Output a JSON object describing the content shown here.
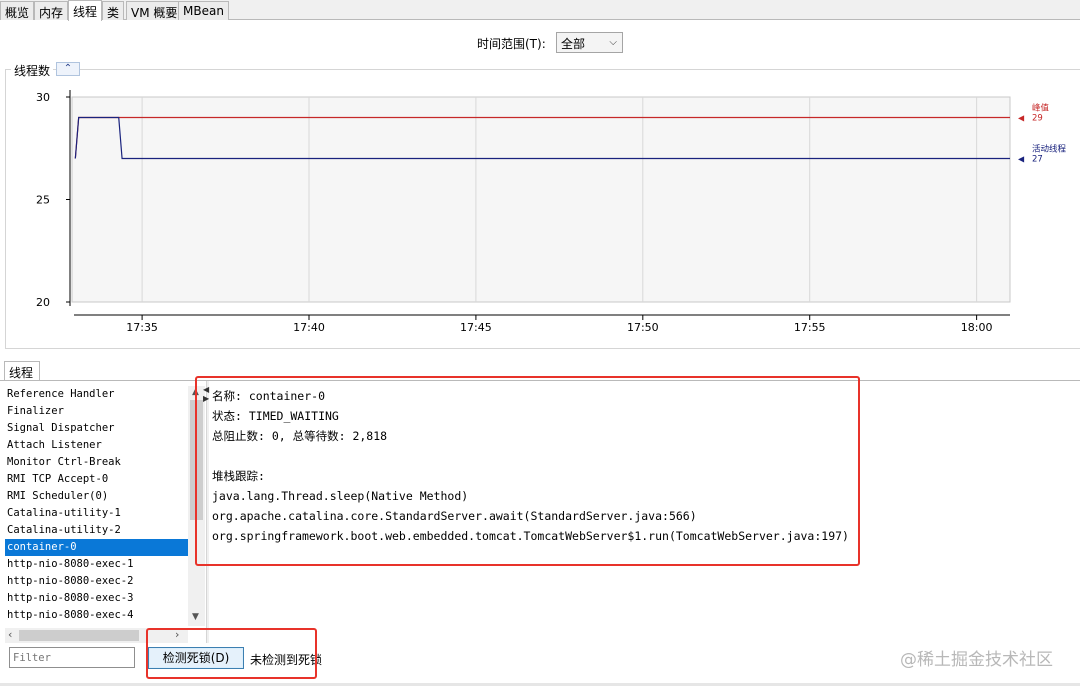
{
  "tabs": [
    {
      "label": "概览"
    },
    {
      "label": "内存"
    },
    {
      "label": "线程"
    },
    {
      "label": "类"
    },
    {
      "label": "VM 概要"
    },
    {
      "label": "MBean"
    }
  ],
  "time_range": {
    "label": "时间范围(T):",
    "value": "全部"
  },
  "threads_panel": {
    "title": "线程数",
    "collapse_icon": "double-chevron-up-icon"
  },
  "chart_data": {
    "type": "line",
    "x_ticks": [
      "17:35",
      "17:40",
      "17:45",
      "17:50",
      "17:55",
      "18:00"
    ],
    "x_tick_minutes": [
      0,
      5,
      10,
      15,
      20,
      25
    ],
    "x_range": [
      -2.1,
      26
    ],
    "y_ticks": [
      30,
      25,
      20
    ],
    "ylim": [
      20,
      30
    ],
    "grid": true,
    "series": [
      {
        "name": "峰值",
        "value_label": "29",
        "color": "#c62828",
        "points": [
          [
            -2.0,
            27
          ],
          [
            -1.9,
            29
          ],
          [
            26,
            29
          ]
        ]
      },
      {
        "name": "活动线程",
        "value_label": "27",
        "color": "#1a237e",
        "points": [
          [
            -2.0,
            27
          ],
          [
            -1.9,
            29
          ],
          [
            -0.7,
            29
          ],
          [
            -0.6,
            27
          ],
          [
            26,
            27
          ]
        ]
      }
    ]
  },
  "threads_tab": {
    "label": "线程"
  },
  "thread_list": [
    "Reference Handler",
    "Finalizer",
    "Signal Dispatcher",
    "Attach Listener",
    "Monitor Ctrl-Break",
    "RMI TCP Accept-0",
    "RMI Scheduler(0)",
    "Catalina-utility-1",
    "Catalina-utility-2",
    "container-0",
    "http-nio-8080-exec-1",
    "http-nio-8080-exec-2",
    "http-nio-8080-exec-3",
    "http-nio-8080-exec-4"
  ],
  "selected_index": 9,
  "details": {
    "name_line": "名称: container-0",
    "state_line": "状态: TIMED_WAITING",
    "counts_line": "总阻止数: 0, 总等待数: 2,818",
    "stack_title": "堆栈跟踪:",
    "stack": [
      "java.lang.Thread.sleep(Native Method)",
      "org.apache.catalina.core.StandardServer.await(StandardServer.java:566)",
      "org.springframework.boot.web.embedded.tomcat.TomcatWebServer$1.run(TomcatWebServer.java:197)"
    ]
  },
  "filter": {
    "placeholder": "Filter"
  },
  "deadlock": {
    "button_label": "检测死锁(D)",
    "status": "未检测到死锁"
  },
  "watermark": "@稀土掘金技术社区",
  "colors": {
    "highlight": "#e8332a",
    "selection": "#0a78d7"
  }
}
